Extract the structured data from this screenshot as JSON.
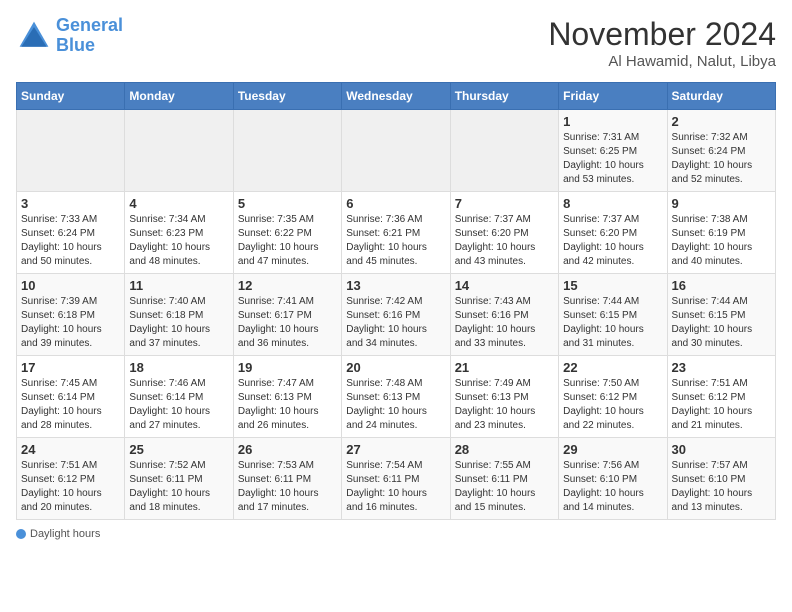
{
  "header": {
    "logo_line1": "General",
    "logo_line2": "Blue",
    "month": "November 2024",
    "location": "Al Hawamid, Nalut, Libya"
  },
  "days_of_week": [
    "Sunday",
    "Monday",
    "Tuesday",
    "Wednesday",
    "Thursday",
    "Friday",
    "Saturday"
  ],
  "legend": {
    "daylight_label": "Daylight hours"
  },
  "weeks": [
    {
      "days": [
        {
          "num": "",
          "info": ""
        },
        {
          "num": "",
          "info": ""
        },
        {
          "num": "",
          "info": ""
        },
        {
          "num": "",
          "info": ""
        },
        {
          "num": "",
          "info": ""
        },
        {
          "num": "1",
          "info": "Sunrise: 7:31 AM\nSunset: 6:25 PM\nDaylight: 10 hours\nand 53 minutes."
        },
        {
          "num": "2",
          "info": "Sunrise: 7:32 AM\nSunset: 6:24 PM\nDaylight: 10 hours\nand 52 minutes."
        }
      ]
    },
    {
      "days": [
        {
          "num": "3",
          "info": "Sunrise: 7:33 AM\nSunset: 6:24 PM\nDaylight: 10 hours\nand 50 minutes."
        },
        {
          "num": "4",
          "info": "Sunrise: 7:34 AM\nSunset: 6:23 PM\nDaylight: 10 hours\nand 48 minutes."
        },
        {
          "num": "5",
          "info": "Sunrise: 7:35 AM\nSunset: 6:22 PM\nDaylight: 10 hours\nand 47 minutes."
        },
        {
          "num": "6",
          "info": "Sunrise: 7:36 AM\nSunset: 6:21 PM\nDaylight: 10 hours\nand 45 minutes."
        },
        {
          "num": "7",
          "info": "Sunrise: 7:37 AM\nSunset: 6:20 PM\nDaylight: 10 hours\nand 43 minutes."
        },
        {
          "num": "8",
          "info": "Sunrise: 7:37 AM\nSunset: 6:20 PM\nDaylight: 10 hours\nand 42 minutes."
        },
        {
          "num": "9",
          "info": "Sunrise: 7:38 AM\nSunset: 6:19 PM\nDaylight: 10 hours\nand 40 minutes."
        }
      ]
    },
    {
      "days": [
        {
          "num": "10",
          "info": "Sunrise: 7:39 AM\nSunset: 6:18 PM\nDaylight: 10 hours\nand 39 minutes."
        },
        {
          "num": "11",
          "info": "Sunrise: 7:40 AM\nSunset: 6:18 PM\nDaylight: 10 hours\nand 37 minutes."
        },
        {
          "num": "12",
          "info": "Sunrise: 7:41 AM\nSunset: 6:17 PM\nDaylight: 10 hours\nand 36 minutes."
        },
        {
          "num": "13",
          "info": "Sunrise: 7:42 AM\nSunset: 6:16 PM\nDaylight: 10 hours\nand 34 minutes."
        },
        {
          "num": "14",
          "info": "Sunrise: 7:43 AM\nSunset: 6:16 PM\nDaylight: 10 hours\nand 33 minutes."
        },
        {
          "num": "15",
          "info": "Sunrise: 7:44 AM\nSunset: 6:15 PM\nDaylight: 10 hours\nand 31 minutes."
        },
        {
          "num": "16",
          "info": "Sunrise: 7:44 AM\nSunset: 6:15 PM\nDaylight: 10 hours\nand 30 minutes."
        }
      ]
    },
    {
      "days": [
        {
          "num": "17",
          "info": "Sunrise: 7:45 AM\nSunset: 6:14 PM\nDaylight: 10 hours\nand 28 minutes."
        },
        {
          "num": "18",
          "info": "Sunrise: 7:46 AM\nSunset: 6:14 PM\nDaylight: 10 hours\nand 27 minutes."
        },
        {
          "num": "19",
          "info": "Sunrise: 7:47 AM\nSunset: 6:13 PM\nDaylight: 10 hours\nand 26 minutes."
        },
        {
          "num": "20",
          "info": "Sunrise: 7:48 AM\nSunset: 6:13 PM\nDaylight: 10 hours\nand 24 minutes."
        },
        {
          "num": "21",
          "info": "Sunrise: 7:49 AM\nSunset: 6:13 PM\nDaylight: 10 hours\nand 23 minutes."
        },
        {
          "num": "22",
          "info": "Sunrise: 7:50 AM\nSunset: 6:12 PM\nDaylight: 10 hours\nand 22 minutes."
        },
        {
          "num": "23",
          "info": "Sunrise: 7:51 AM\nSunset: 6:12 PM\nDaylight: 10 hours\nand 21 minutes."
        }
      ]
    },
    {
      "days": [
        {
          "num": "24",
          "info": "Sunrise: 7:51 AM\nSunset: 6:12 PM\nDaylight: 10 hours\nand 20 minutes."
        },
        {
          "num": "25",
          "info": "Sunrise: 7:52 AM\nSunset: 6:11 PM\nDaylight: 10 hours\nand 18 minutes."
        },
        {
          "num": "26",
          "info": "Sunrise: 7:53 AM\nSunset: 6:11 PM\nDaylight: 10 hours\nand 17 minutes."
        },
        {
          "num": "27",
          "info": "Sunrise: 7:54 AM\nSunset: 6:11 PM\nDaylight: 10 hours\nand 16 minutes."
        },
        {
          "num": "28",
          "info": "Sunrise: 7:55 AM\nSunset: 6:11 PM\nDaylight: 10 hours\nand 15 minutes."
        },
        {
          "num": "29",
          "info": "Sunrise: 7:56 AM\nSunset: 6:10 PM\nDaylight: 10 hours\nand 14 minutes."
        },
        {
          "num": "30",
          "info": "Sunrise: 7:57 AM\nSunset: 6:10 PM\nDaylight: 10 hours\nand 13 minutes."
        }
      ]
    }
  ]
}
